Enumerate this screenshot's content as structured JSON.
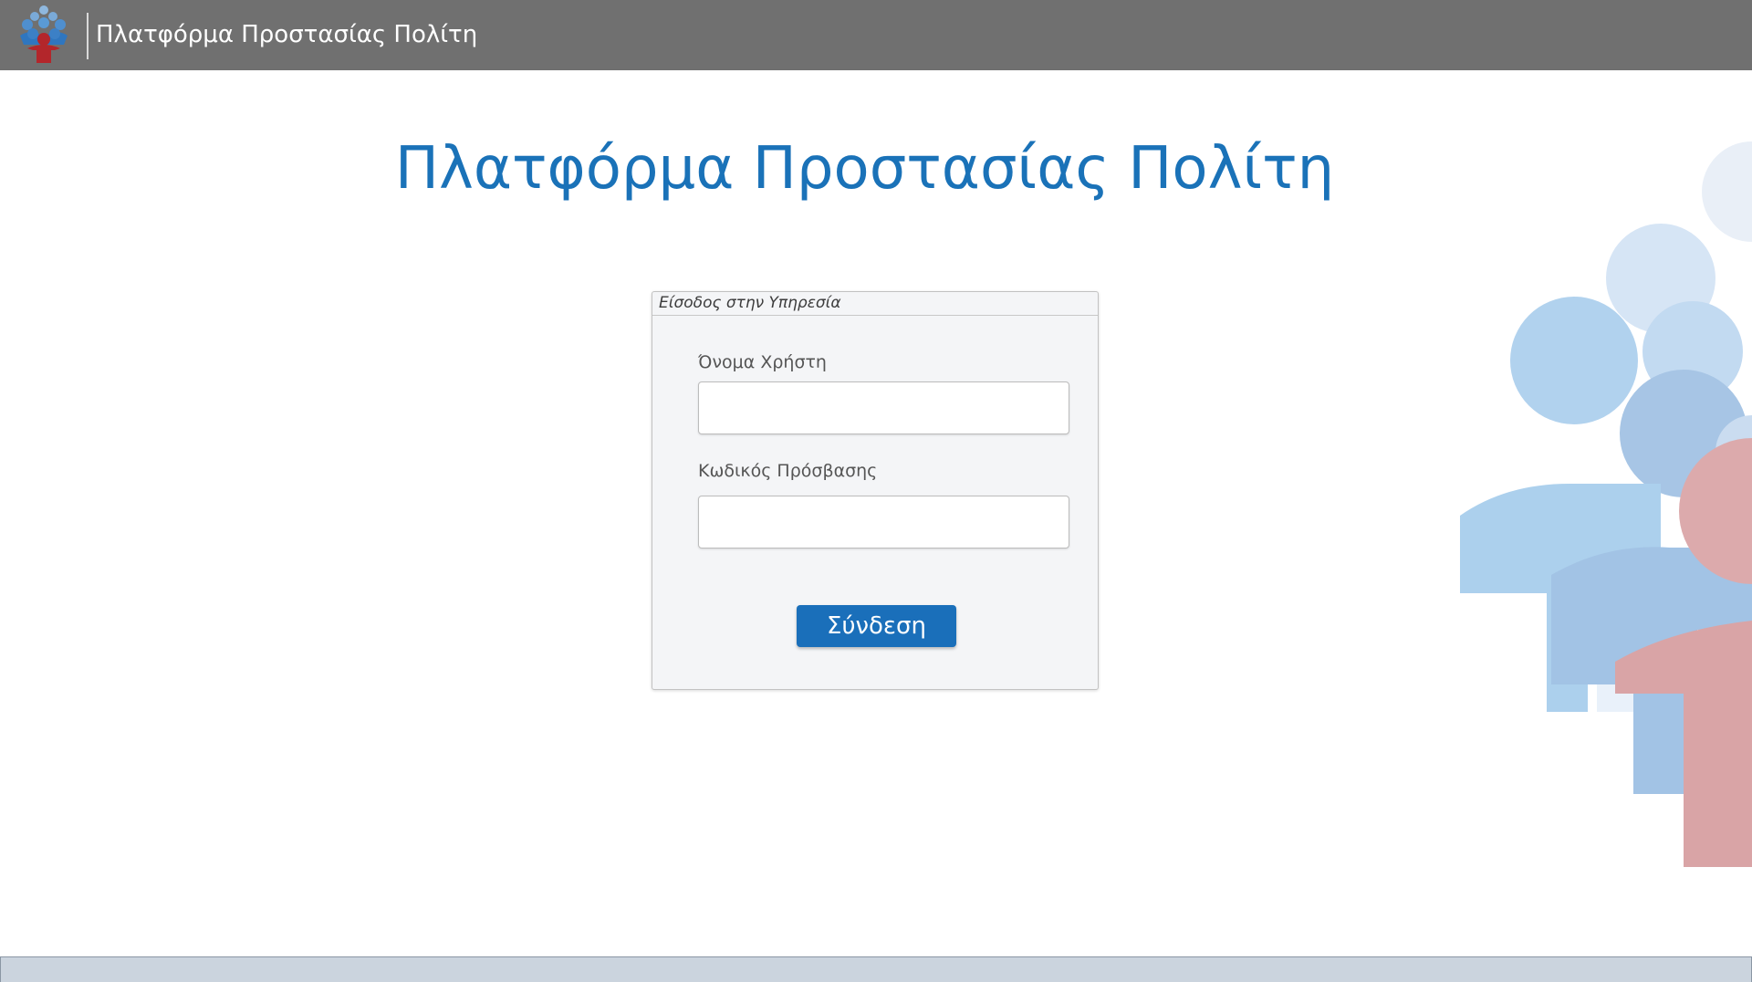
{
  "header": {
    "title": "Πλατφόρμα Προστασίας Πολίτη",
    "logo_icon": "civil-protection-people-logo-icon"
  },
  "main": {
    "title": "Πλατφόρμα Προστασίας Πολίτη"
  },
  "login_panel": {
    "header": "Είσοδος στην Υπηρεσία",
    "username_label": "Όνομα Χρήστη",
    "username_value": "",
    "password_label": "Κωδικός Πρόσβασης",
    "password_value": "",
    "submit_label": "Σύνδεση"
  },
  "colors": {
    "header_bg": "#707070",
    "title": "#1a72b8",
    "button": "#1a6fba",
    "bottom_bar": "#cbd4de"
  }
}
